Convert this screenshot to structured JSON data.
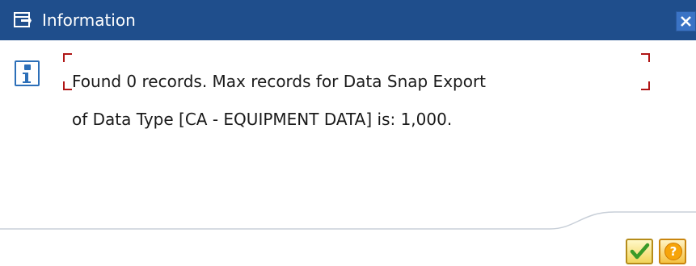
{
  "window": {
    "title": "Information",
    "close_label": "Close"
  },
  "message": {
    "line1": "Found 0 records. Max records for Data Snap Export",
    "line2": "of Data Type [CA - EQUIPMENT DATA] is: 1,000."
  },
  "buttons": {
    "ok_icon": "checkmark-icon",
    "help_icon": "help-icon",
    "help_glyph": "?"
  },
  "colors": {
    "titlebar": "#1f4e8c",
    "focus_corners": "#b01616",
    "info_icon": "#2c6fb8"
  }
}
